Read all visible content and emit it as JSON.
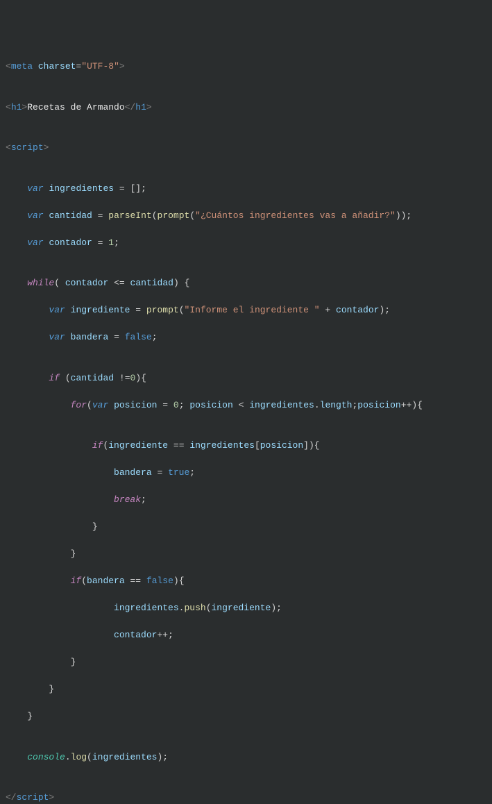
{
  "tags": {
    "meta": "meta",
    "charset_attr": "charset",
    "utf8": "\"UTF-8\"",
    "h1": "h1",
    "h1_close": "h1",
    "script": "script",
    "script_close": "script"
  },
  "text": {
    "heading": "Recetas de Armando"
  },
  "code": {
    "var_kw": "var",
    "ingredientes": "ingredientes",
    "cantidad": "cantidad",
    "contador": "contador",
    "parseInt": "parseInt",
    "prompt": "prompt",
    "q1": "\"¿Cuántos ingredientes vas a añadir?\"",
    "one": "1",
    "zero": "0",
    "while": "while",
    "ingrediente": "ingrediente",
    "q2": "\"Informe el ingrediente \"",
    "bandera": "bandera",
    "false": "false",
    "true": "true",
    "if": "if",
    "for": "for",
    "posicion": "posicion",
    "length": "length",
    "break": "break",
    "push": "push",
    "console": "console",
    "log": "log"
  }
}
